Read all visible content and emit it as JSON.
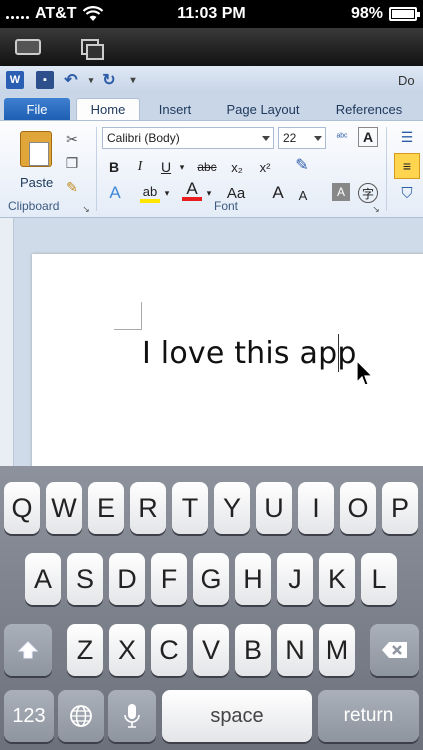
{
  "status_bar": {
    "carrier": "AT&T",
    "time": "11:03 PM",
    "battery_percent": "98%",
    "battery_level": 0.98
  },
  "app_bar": {
    "keyboard_icon": "keyboard-icon",
    "window_icon": "windows-icon"
  },
  "word": {
    "app_icon_letter": "W",
    "doc_title": "Do",
    "tabs": [
      "File",
      "Home",
      "Insert",
      "Page Layout",
      "References"
    ],
    "clipboard": {
      "paste_label": "Paste",
      "group_label": "Clipboard"
    },
    "font": {
      "font_name": "Calibri (Body)",
      "font_size": "22",
      "group_label": "Font",
      "buttons": [
        "B",
        "I",
        "U",
        "abc",
        "x₂",
        "x²",
        "A",
        "A",
        "Aa",
        "A",
        "A"
      ]
    },
    "document_text": "I love this app"
  },
  "keyboard": {
    "row1": [
      "Q",
      "W",
      "E",
      "R",
      "T",
      "Y",
      "U",
      "I",
      "O",
      "P"
    ],
    "row2": [
      "A",
      "S",
      "D",
      "F",
      "G",
      "H",
      "J",
      "K",
      "L"
    ],
    "row3": [
      "Z",
      "X",
      "C",
      "V",
      "B",
      "N",
      "M"
    ],
    "numbers_label": "123",
    "space_label": "space",
    "return_label": "return"
  },
  "colors": {
    "file_tab": "#2b6cc4",
    "ribbon_bg": "#e4ecf7",
    "keyboard_bg": "#7c818b"
  }
}
